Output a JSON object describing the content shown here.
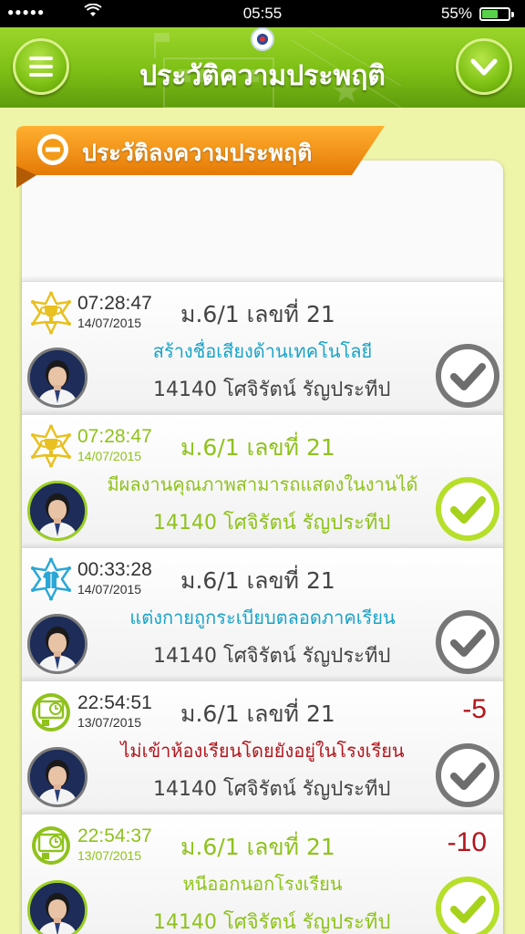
{
  "status_bar": {
    "signal": "●●●●●",
    "wifi": "wifi-icon",
    "time": "05:55",
    "battery_percent": "55%",
    "battery_level": 0.55
  },
  "header": {
    "title": "ประวัติความประพฤติ",
    "menu_icon": "hamburger-menu-icon",
    "dropdown_icon": "chevron-down-icon",
    "accent": "#7dbf16"
  },
  "section": {
    "title": "ประวัติลงความประพฤติ",
    "collapse_icon": "minus-circle-icon",
    "accent": "#f28c0f"
  },
  "records": [
    {
      "badge": "trophy-star-icon",
      "badge_color": "#e8c020",
      "time": "07:28:47",
      "date": "14/07/2015",
      "class": "ม.6/1 เลขที่ 21",
      "behavior": "สร้างชื่อเสียงด้านเทคโนโลยี",
      "behavior_color": "blue",
      "student": "14140 โศจิรัตน์ รัญประทีป",
      "points": "",
      "checked": false
    },
    {
      "badge": "trophy-star-icon",
      "badge_color": "#e8c020",
      "time": "07:28:47",
      "date": "14/07/2015",
      "class": "ม.6/1 เลขที่ 21",
      "behavior": "มีผลงานคุณภาพสามารถแสดงในงานได้",
      "behavior_color": "green",
      "student": "14140 โศจิรัตน์ รัญประทีป",
      "points": "",
      "checked": true
    },
    {
      "badge": "uniform-star-icon",
      "badge_color": "#2aa7d6",
      "time": "00:33:28",
      "date": "14/07/2015",
      "class": "ม.6/1 เลขที่ 21",
      "behavior": "แต่งกายถูกระเบียบตลอดภาคเรียน",
      "behavior_color": "blue",
      "student": "14140 โศจิรัตน์ รัญประทีป",
      "points": "",
      "checked": false
    },
    {
      "badge": "clock-classroom-icon",
      "badge_color": "#8fc21c",
      "time": "22:54:51",
      "date": "13/07/2015",
      "class": "ม.6/1 เลขที่ 21",
      "behavior": "ไม่เข้าห้องเรียนโดยยังอยู่ในโรงเรียน",
      "behavior_color": "red",
      "student": "14140 โศจิรัตน์ รัญประทีป",
      "points": "-5",
      "checked": false
    },
    {
      "badge": "clock-classroom-icon",
      "badge_color": "#8fc21c",
      "time": "22:54:37",
      "date": "13/07/2015",
      "class": "ม.6/1 เลขที่ 21",
      "behavior": "หนีออกนอกโรงเรียน",
      "behavior_color": "green",
      "student": "14140 โศจิรัตน์ รัญประทีป",
      "points": "-10",
      "checked": true
    }
  ]
}
